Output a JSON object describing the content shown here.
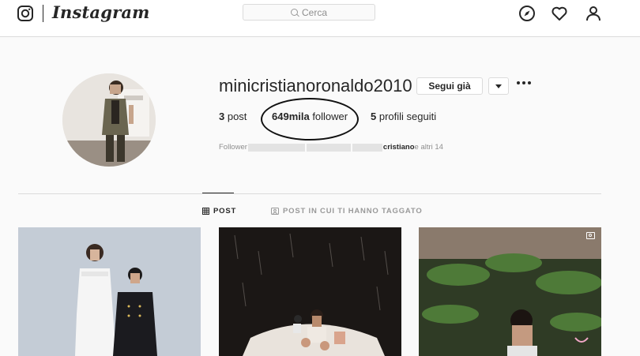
{
  "header": {
    "wordmark": "Instagram",
    "search_placeholder": "Cerca",
    "nav_icons": [
      "instagram-logo-icon",
      "compass-icon",
      "heart-icon",
      "user-icon"
    ]
  },
  "profile": {
    "username": "minicristianoronaldo2010",
    "follow_button": "Segui già",
    "posts_count": "3",
    "posts_label": " post",
    "followers_count": "649mila",
    "followers_label": " follower",
    "following_count": "5",
    "following_label": " profili seguiti",
    "followed_by_prefix": "Follower",
    "followed_by_name": "cristiano",
    "followed_by_suffix": " e altri 14"
  },
  "tabs": [
    {
      "label": "POST",
      "icon": "grid-icon",
      "active": true
    },
    {
      "label": "POST IN CUI TI HANNO TAGGATO",
      "icon": "tag-icon",
      "active": false
    }
  ],
  "colors": {
    "background": "#fafafa",
    "border": "#dbdbdb",
    "text": "#262626",
    "muted": "#8e8e8e"
  }
}
